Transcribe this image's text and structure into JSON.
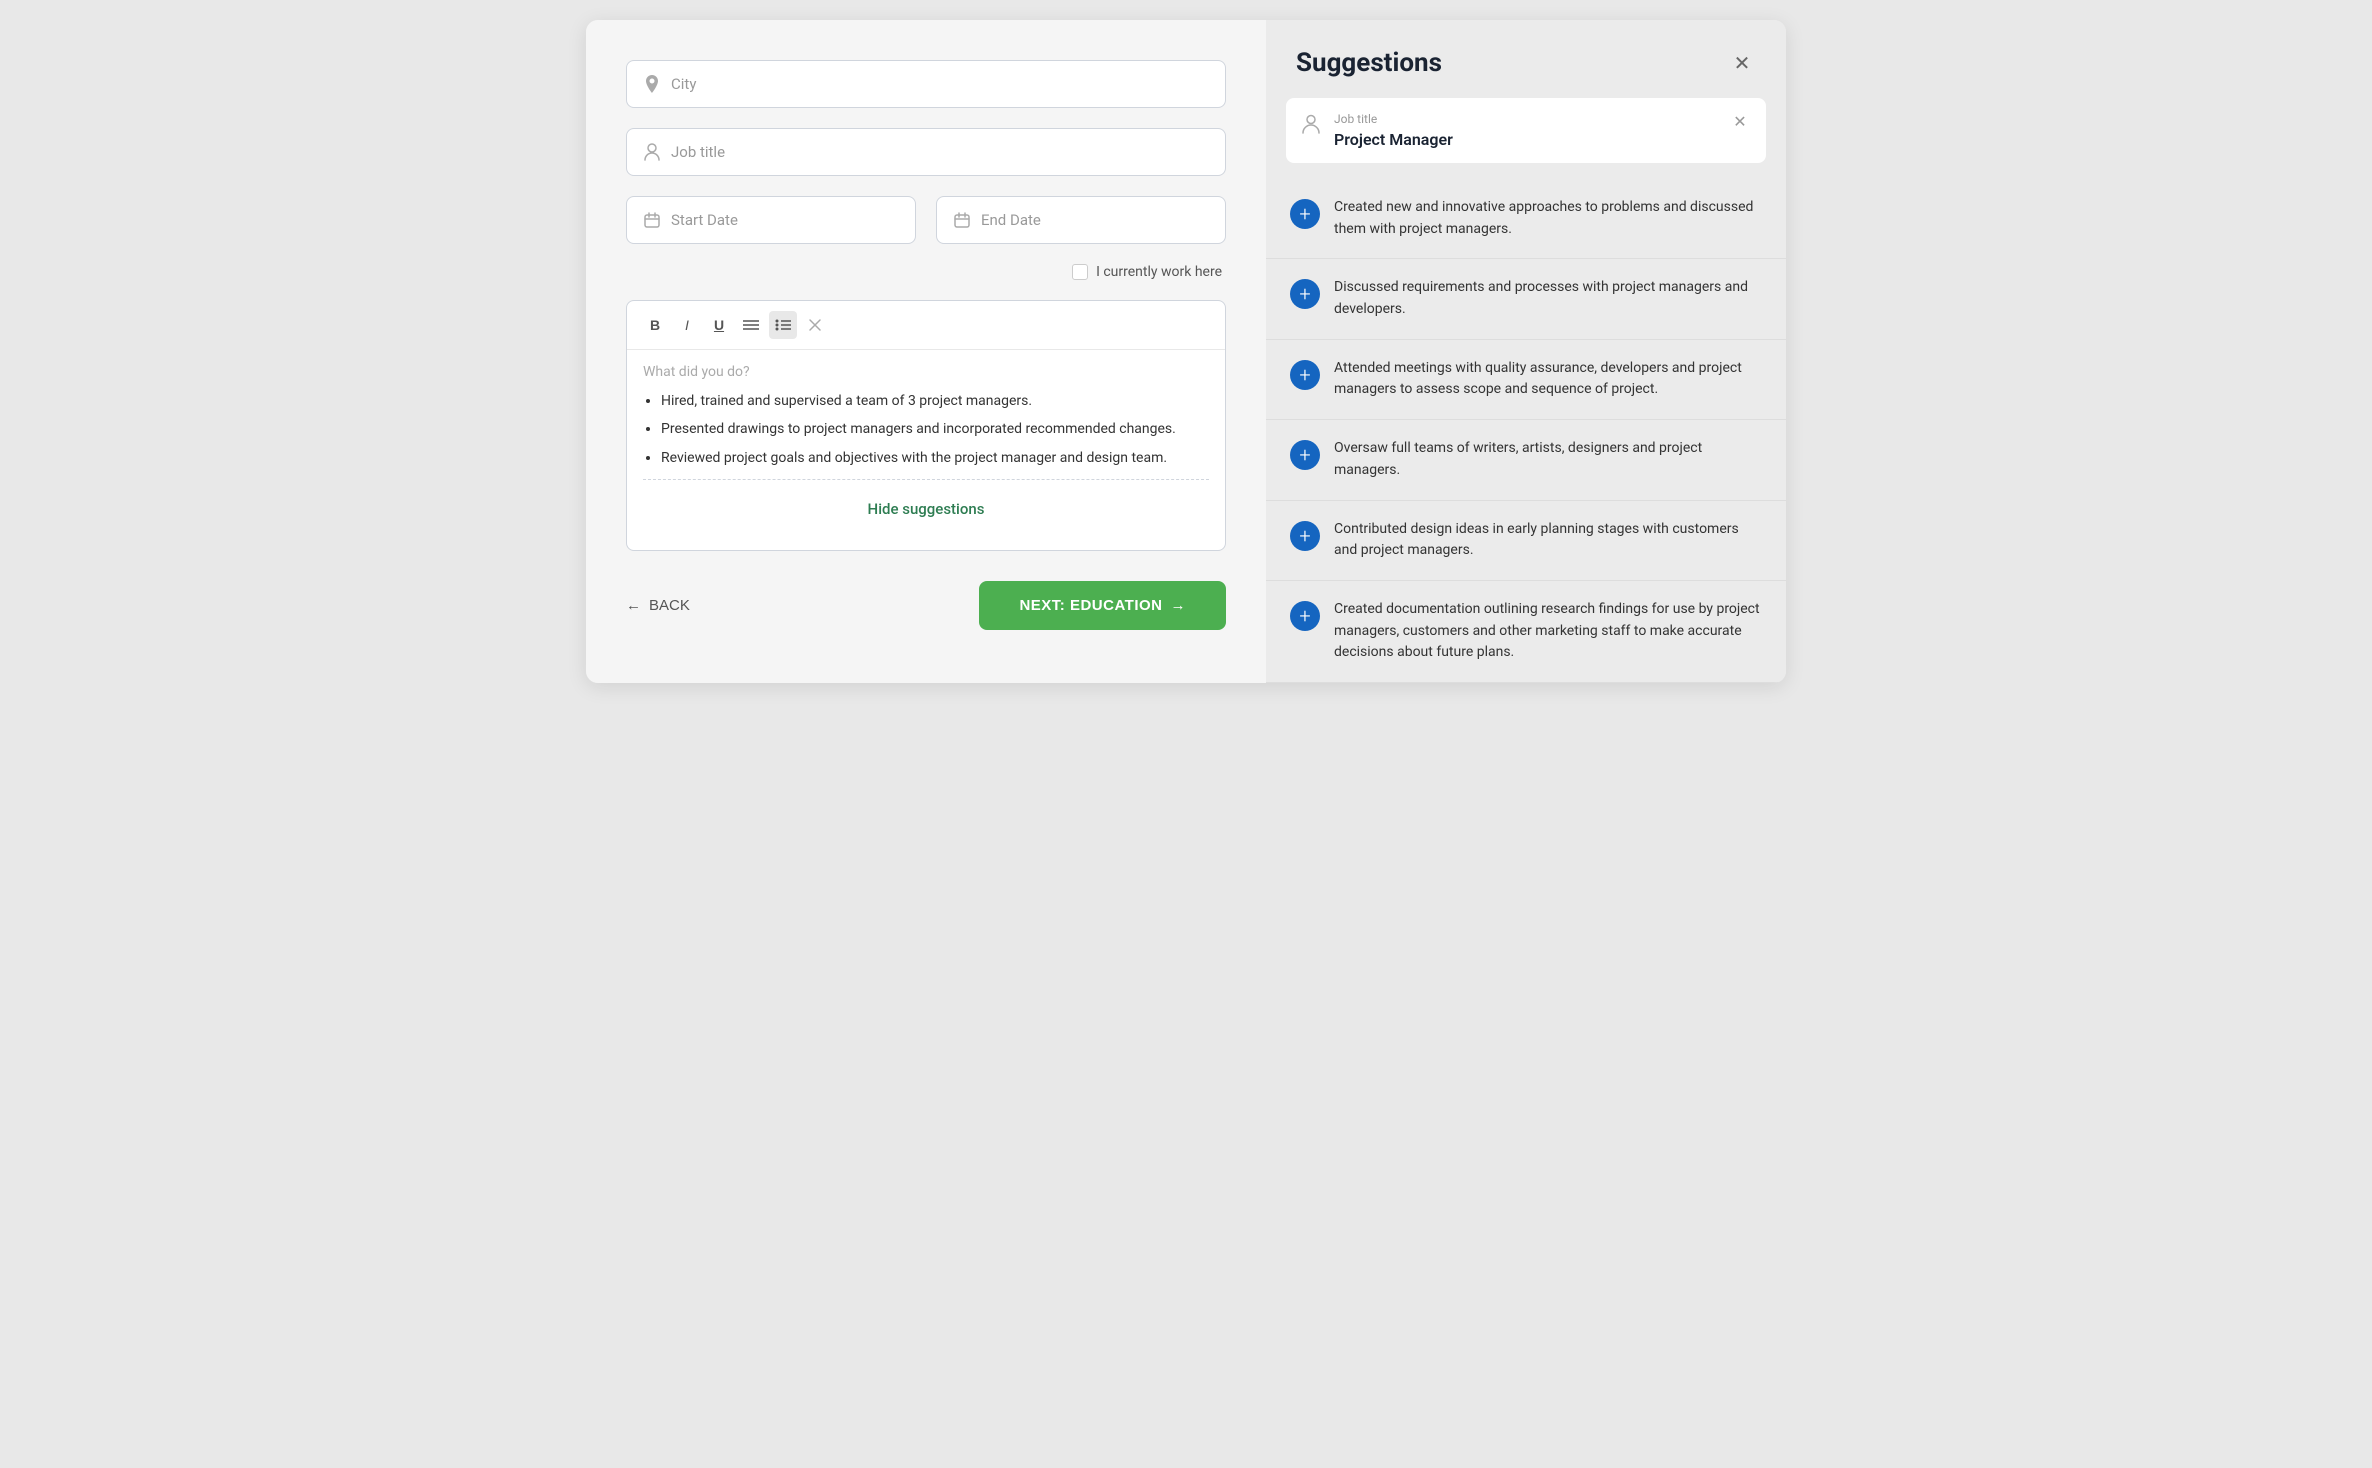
{
  "leftPanel": {
    "cityField": {
      "placeholder": "City",
      "icon": "location"
    },
    "jobTitleField": {
      "placeholder": "Job title",
      "icon": "person"
    },
    "startDateField": {
      "placeholder": "Start Date",
      "icon": "calendar"
    },
    "endDateField": {
      "placeholder": "End Date",
      "icon": "calendar"
    },
    "checkboxLabel": "I currently work here",
    "editorPlaceholder": "What did you do?",
    "editorBullets": [
      "Hired, trained and supervised a team of 3 project managers.",
      "Presented drawings to project managers and incorporated recommended changes.",
      "Reviewed project goals and objectives with the project manager and design team."
    ],
    "hideSuggestionsLabel": "Hide suggestions",
    "toolbar": {
      "bold": "B",
      "italic": "I",
      "underline": "U",
      "align": "≡",
      "list": "≡",
      "clear": "✕"
    },
    "backButton": "BACK",
    "nextButton": "NEXT: EDUCATION"
  },
  "rightPanel": {
    "title": "Suggestions",
    "jobTitleLabel": "Job title",
    "jobTitleValue": "Project Manager",
    "suggestions": [
      {
        "id": 1,
        "text": "Created new and innovative approaches to problems and discussed them with project managers."
      },
      {
        "id": 2,
        "text": "Discussed requirements and processes with project managers and developers."
      },
      {
        "id": 3,
        "text": "Attended meetings with quality assurance, developers and project managers to assess scope and sequence of project."
      },
      {
        "id": 4,
        "text": "Oversaw full teams of writers, artists, designers and project managers."
      },
      {
        "id": 5,
        "text": "Contributed design ideas in early planning stages with customers and project managers."
      },
      {
        "id": 6,
        "text": "Created documentation outlining research findings for use by project managers, customers and other marketing staff to make accurate decisions about future plans."
      }
    ]
  }
}
